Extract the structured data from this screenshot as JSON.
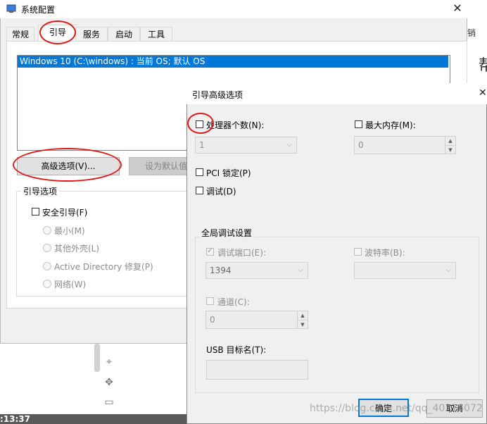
{
  "main_window": {
    "title": "系统配置",
    "close_glyph": "✕",
    "tabs": [
      "常规",
      "引导",
      "服务",
      "启动",
      "工具"
    ],
    "os_list": [
      "Windows 10 (C:\\windows) : 当前 OS; 默认 OS"
    ],
    "advanced_button": "高级选项(V)...",
    "set_default_button": "设为默认值",
    "boot_options": {
      "title": "引导选项",
      "safe_boot": "安全引导(F)",
      "radios": [
        "最小(M)",
        "其他外壳(L)",
        "Active Directory 修复(P)",
        "网络(W)"
      ]
    }
  },
  "right_strip": {
    "text1": "销",
    "text2": "帮"
  },
  "bottom": {
    "time": ":13:37"
  },
  "dialog": {
    "title": "引导高级选项",
    "close_glyph": "✕",
    "processor_count": {
      "label": "处理器个数(N):",
      "value": "1",
      "checked": false
    },
    "max_memory": {
      "label": "最大内存(M):",
      "value": "0",
      "checked": false
    },
    "pci_lock": {
      "label": "PCI 锁定(P)",
      "checked": false
    },
    "debug": {
      "label": "调试(D)",
      "checked": false
    },
    "global_debug": {
      "title": "全局调试设置",
      "debug_port": {
        "label": "调试端口(E):",
        "value": "1394",
        "checked": true
      },
      "baud_rate": {
        "label": "波特率(B):",
        "value": ""
      },
      "channel": {
        "label": "通道(C):",
        "value": "0"
      },
      "usb_target": {
        "label": "USB 目标名(T):",
        "value": ""
      }
    },
    "ok_button": "确定",
    "cancel_button": "取消"
  },
  "watermark": "https://blog.csdn.net/qq_40214072"
}
